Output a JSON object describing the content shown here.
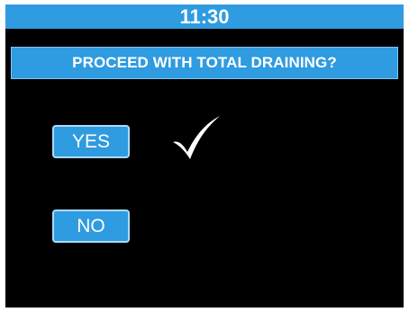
{
  "status_bar": {
    "time": "11:30"
  },
  "dialog": {
    "title": "PROCEED WITH TOTAL DRAINING?"
  },
  "buttons": {
    "yes_label": "YES",
    "no_label": "NO"
  },
  "selection": {
    "selected": "YES",
    "indicator_icon": "checkmark-icon"
  },
  "colors": {
    "accent": "#2f9be0",
    "button_border": "#a9dcfa",
    "background": "#000000",
    "text": "#ffffff"
  }
}
